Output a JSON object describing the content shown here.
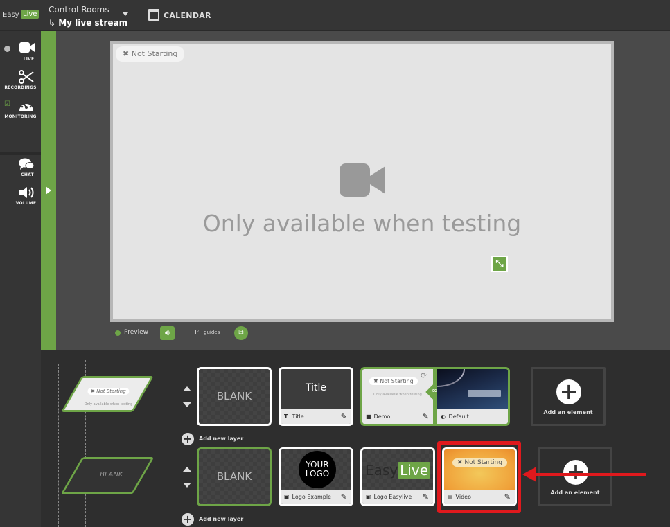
{
  "header": {
    "logo_easy": "Easy",
    "logo_live": "Live",
    "control_rooms": "Control Rooms",
    "stream_name": "My live stream",
    "calendar": "CALENDAR"
  },
  "nav": {
    "live": "LIVE",
    "recordings": "RECORDINGS",
    "monitoring": "MONITORING",
    "chat": "CHAT",
    "volume": "VOLUME"
  },
  "preview": {
    "status": "Not Starting",
    "message": "Only available when testing",
    "preview_label": "Preview",
    "guides_label": "guides"
  },
  "diagram": {
    "top_status": "Not Starting",
    "top_message": "Only available when testing",
    "bottom_label": "BLANK"
  },
  "layers": [
    {
      "tiles": [
        {
          "kind": "blank",
          "text": "BLANK"
        },
        {
          "kind": "title",
          "preview_text": "Title",
          "label": "Title"
        },
        {
          "kind": "demo",
          "status": "Not Starting",
          "message": "Only available when testing",
          "label": "Demo"
        },
        {
          "kind": "default",
          "label": "Default"
        }
      ],
      "add_element": "Add an element",
      "add_layer": "Add new layer"
    },
    {
      "tiles": [
        {
          "kind": "blank",
          "text": "BLANK"
        },
        {
          "kind": "logo",
          "logo_line1": "YOUR",
          "logo_line2": "LOGO",
          "label": "Logo Example"
        },
        {
          "kind": "logo-easylive",
          "logo_easy": "Easy",
          "logo_live": "Live",
          "label": "Logo Easylive"
        },
        {
          "kind": "video",
          "status": "Not Starting",
          "label": "Video"
        }
      ],
      "add_element": "Add an element",
      "add_layer": "Add new layer"
    }
  ],
  "colors": {
    "accent_green": "#6ea547",
    "highlight_red": "#e0191d",
    "background": "#3a3a3a"
  }
}
